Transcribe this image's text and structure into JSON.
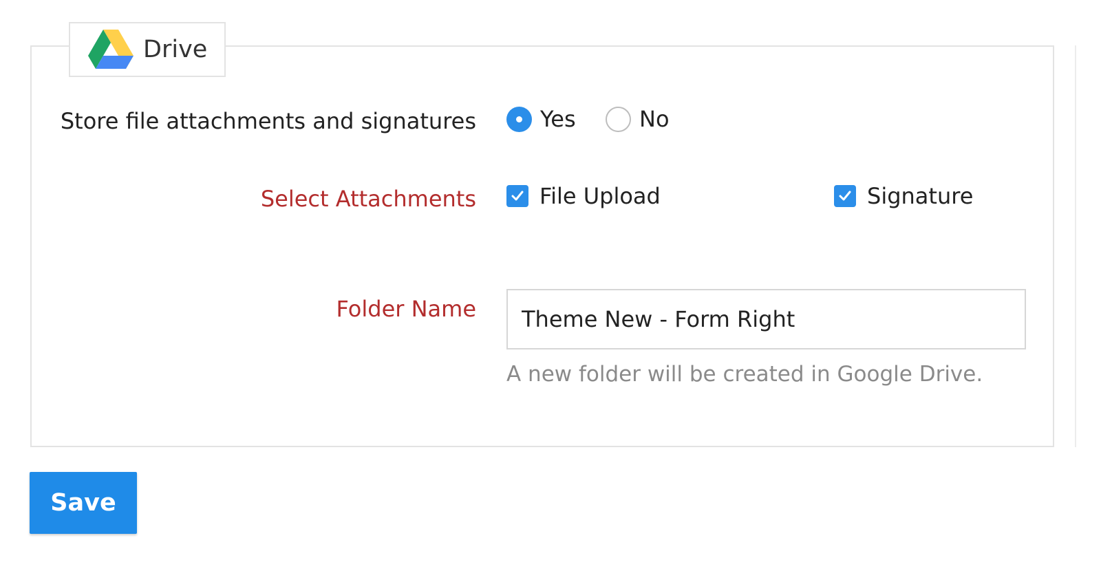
{
  "integration": {
    "tab_label": "Drive",
    "logo_icon": "google-drive-icon"
  },
  "store_attachments": {
    "label": "Store file attachments and signatures",
    "options": [
      {
        "label": "Yes",
        "selected": true
      },
      {
        "label": "No",
        "selected": false
      }
    ]
  },
  "select_attachments": {
    "label": "Select Attachments",
    "options": [
      {
        "label": "File Upload",
        "checked": true
      },
      {
        "label": "Signature",
        "checked": true
      }
    ]
  },
  "folder_name": {
    "label": "Folder Name",
    "value": "Theme New - Form Right",
    "help": "A new folder will be created in Google Drive."
  },
  "actions": {
    "save_label": "Save"
  },
  "colors": {
    "accent": "#2b8ee9",
    "save_button": "#1f8be8",
    "required_label": "#b32d2d",
    "help_text": "#8a8a8a",
    "drive_green": "#1fa463",
    "drive_yellow": "#ffd04b",
    "drive_blue": "#4688f4"
  }
}
